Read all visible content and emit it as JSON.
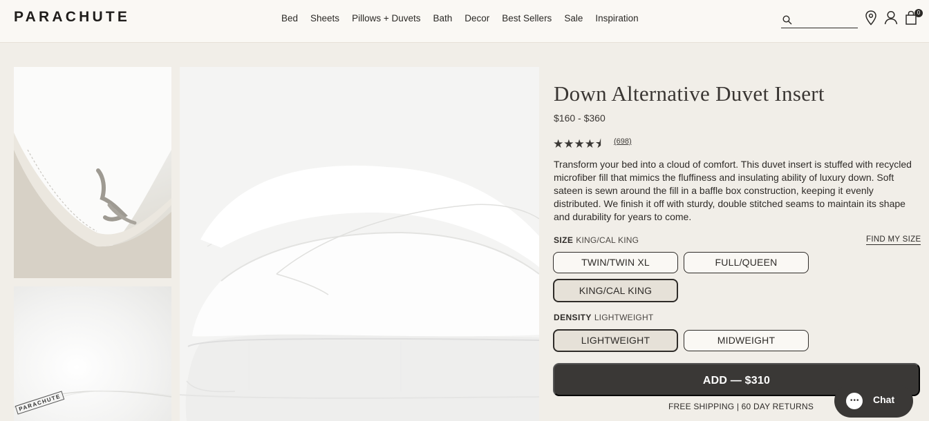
{
  "brand": {
    "logo": "PARACHUTE"
  },
  "nav": {
    "items": [
      "Bed",
      "Sheets",
      "Pillows + Duvets",
      "Bath",
      "Decor",
      "Best Sellers",
      "Sale",
      "Inspiration"
    ]
  },
  "header": {
    "search_value": "",
    "icons": [
      "search-icon",
      "location-pin-icon",
      "account-icon",
      "cart-icon"
    ],
    "cart_count": "0"
  },
  "product": {
    "title": "Down Alternative Duvet Insert",
    "price": "$160 - $360",
    "rating": 4.5,
    "stars_text": "★★★★⯨",
    "review_count": "(698)",
    "description": "Transform your bed into a cloud of comfort. This duvet insert is stuffed with recycled microfiber fill that mimics the fluffiness and insulating ability of luxury down. Soft sateen is sewn around the fill in a baffle box construction, keeping it evenly distributed. We finish it off with sturdy, double stitched seams to maintain its shape and durability for years to come.",
    "thumb_logo": "PARACHUTE"
  },
  "size": {
    "label": "SIZE",
    "selected": "KING/CAL KING",
    "find_my_size": "FIND MY SIZE",
    "options": [
      "TWIN/TWIN XL",
      "FULL/QUEEN",
      "KING/CAL KING"
    ]
  },
  "density": {
    "label": "DENSITY",
    "selected": "LIGHTWEIGHT",
    "options": [
      "LIGHTWEIGHT",
      "MIDWEIGHT"
    ]
  },
  "cta": {
    "add_label": "ADD — $310",
    "shipping": "FREE SHIPPING | 60 DAY RETURNS"
  },
  "chat": {
    "label": "Chat",
    "dots": "•••"
  },
  "colors": {
    "page_bg": "#f1eee8",
    "header_bg": "#faf8f4",
    "text": "#2e2b28",
    "button_dark": "#3a3836",
    "selected_option_bg": "#e6e1d8"
  }
}
